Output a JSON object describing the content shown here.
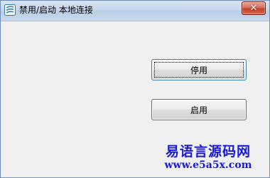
{
  "window": {
    "title": "禁用/启动 本地连接",
    "app_icon": "app-logo-icon",
    "close_glyph": "✕"
  },
  "buttons": {
    "disable_label": "停用",
    "enable_label": "启用"
  },
  "watermark": {
    "name": "易语言源码网",
    "url": "www.e5a5x.com"
  },
  "colors": {
    "title_bar": "#c9daee",
    "body": "#f0f0f0",
    "close_button": "#c44128",
    "watermark": "#1a1ad6"
  }
}
